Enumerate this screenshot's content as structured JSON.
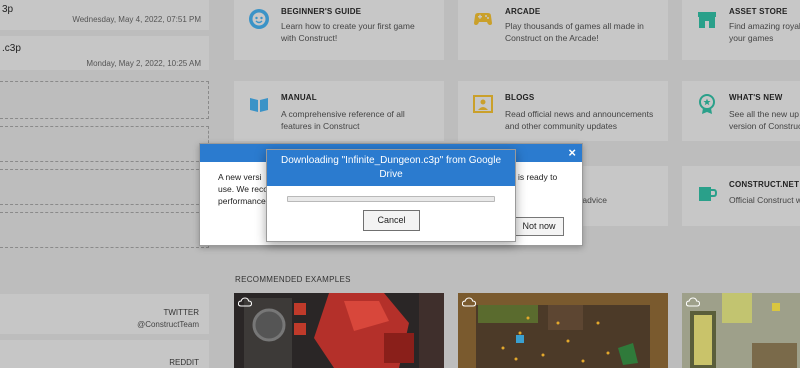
{
  "recent_files": [
    {
      "name": "3p",
      "date": "Wednesday, May 4, 2022, 07:51 PM"
    },
    {
      "name": ".c3p",
      "date": "Monday, May 2, 2022, 10:25 AM"
    }
  ],
  "social": [
    {
      "title": "TWITTER",
      "handle": "@ConstructTeam"
    },
    {
      "title": "REDDIT",
      "handle": ""
    }
  ],
  "cards": [
    {
      "title": "BEGINNER'S GUIDE",
      "desc1": "Learn how to create your first game",
      "desc2": "with Construct!",
      "icon": "smiley-icon"
    },
    {
      "title": "ARCADE",
      "desc1": "Play thousands of games all made in",
      "desc2": "Construct on the Arcade!",
      "icon": "gamepad-icon"
    },
    {
      "title": "ASSET STORE",
      "desc1": "Find amazing royalty",
      "desc2": "your games",
      "icon": "store-icon"
    },
    {
      "title": "MANUAL",
      "desc1": "A comprehensive reference of all",
      "desc2": "features in Construct",
      "icon": "book-icon"
    },
    {
      "title": "BLOGS",
      "desc1": "Read official news and announcements",
      "desc2": "and other community updates",
      "icon": "blog-icon"
    },
    {
      "title": "WHAT'S NEW",
      "desc1": "See all the new up",
      "desc2": "version of Construct",
      "icon": "badge-icon"
    },
    {
      "title": "CONSTRUCT.NET",
      "desc1": "Official Construct w",
      "desc2": "",
      "icon": "mug-icon"
    }
  ],
  "forum_snippet": "et help and advice",
  "section_title": "RECOMMENDED EXAMPLES",
  "update_dialog": {
    "close_symbol": "×",
    "left_lines": [
      "A new versi",
      "use. We reco",
      "performance"
    ],
    "right_line": "is ready to",
    "not_now_label": "Not now"
  },
  "download_dialog": {
    "title": "Downloading \"Infinite_Dungeon.c3p\" from Google Drive",
    "progress": 0,
    "cancel_label": "Cancel"
  },
  "colors": {
    "accent": "#2b7bcf",
    "icon_blue": "#3a93c7",
    "icon_orange": "#e08a2a",
    "icon_yellow": "#caa02a",
    "icon_teal": "#2aa08a"
  }
}
